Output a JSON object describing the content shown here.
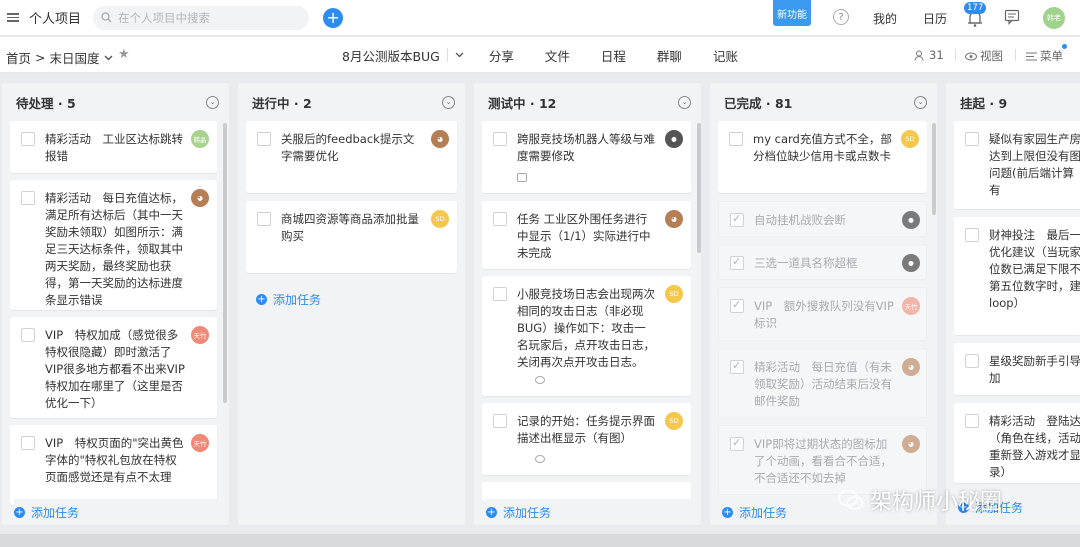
{
  "topbar": {
    "title": "个人项目",
    "search_placeholder": "在个人项目中搜索",
    "new_feature": "新功能",
    "help": "?",
    "mine": "我的",
    "calendar": "日历",
    "notify_count": "177",
    "avatar_text": "韩老"
  },
  "subbar": {
    "crumb_home": "首页",
    "crumb_sep": ">",
    "crumb_current": "末日国度",
    "tabs": [
      "8月公测版本BUG",
      "分享",
      "文件",
      "日程",
      "群聊",
      "记账"
    ],
    "members": "31",
    "view": "视图",
    "menu": "菜单"
  },
  "columns": [
    {
      "title": "待处理 · 5",
      "add": "添加任务",
      "cards": [
        {
          "text": "精彩活动　工业区达标跳转报错",
          "av": "韩晶"
        },
        {
          "text": "精彩活动　每日充值达标，满足所有达标后（其中一天奖励未领取）如图所示：满足三天达标条件，领取其中两天奖励，最终奖励也获得，第一天奖励的达标进度条显示错误"
        },
        {
          "text": "VIP　特权加成（感觉很多特权很隐藏）即时激活了VIP很多地方都看不出来VIP 特权加在哪里了（这里是否优化一下）",
          "av": "天竹"
        },
        {
          "text": "VIP　特权页面的\"突出黄色字体的\"特权礼包放在特权页面感觉还是有点不太理",
          "av": "天竹"
        }
      ]
    },
    {
      "title": "进行中 · 2",
      "add": "添加任务",
      "cards": [
        {
          "text": "关服后的feedback提示文字需要优化"
        },
        {
          "text": "商城四资源等商品添加批量购买",
          "av": "SD"
        }
      ]
    },
    {
      "title": "测试中 · 12",
      "add": "添加任务",
      "cards": [
        {
          "text": "跨服竞技场机器人等级与难度需要修改"
        },
        {
          "text": "任务 工业区外围任务进行中显示（1/1）实际进行中未完成"
        },
        {
          "text": "小服竞技场日志会出现两次相同的攻击日志（非必现BUG）操作如下：攻击一名玩家后，点开攻击日志，关闭再次点开攻击日志。",
          "av": "SD"
        },
        {
          "text": "记录的开始：任务提示界面描述出框显示（有图）",
          "av": "SD"
        }
      ]
    },
    {
      "title": "已完成 · 81",
      "add": "添加任务",
      "cards": [
        {
          "text": "my card充值方式不全，部分档位缺少信用卡或点数卡",
          "av": "SD"
        },
        {
          "text": "自动挂机战败会断"
        },
        {
          "text": "三选一道具名称超框"
        },
        {
          "text": "VIP　额外搜救队列没有VIP标识",
          "av": "天竹"
        },
        {
          "text": "精彩活动　每日充值（有未领取奖励）活动结束后没有邮件奖励"
        },
        {
          "text": "VIP即将过期状态的图标加了个动画，看看合不合适，不合适还不如去掉"
        }
      ]
    },
    {
      "title": "挂起 · 9",
      "add": "添加任务",
      "cards": [
        {
          "text": "疑似有家园生产房达到上限但没有图问题(前后端计算有"
        },
        {
          "text": "财神投注　最后一优化建议（当玩家位数已满足下限不第五位数字时，建loop）"
        },
        {
          "text": "星级奖励新手引导加"
        },
        {
          "text": "精彩活动　登陆达（角色在线，活动重新登入游戏才显录）"
        }
      ]
    }
  ],
  "watermark": "架构师小秘圈"
}
